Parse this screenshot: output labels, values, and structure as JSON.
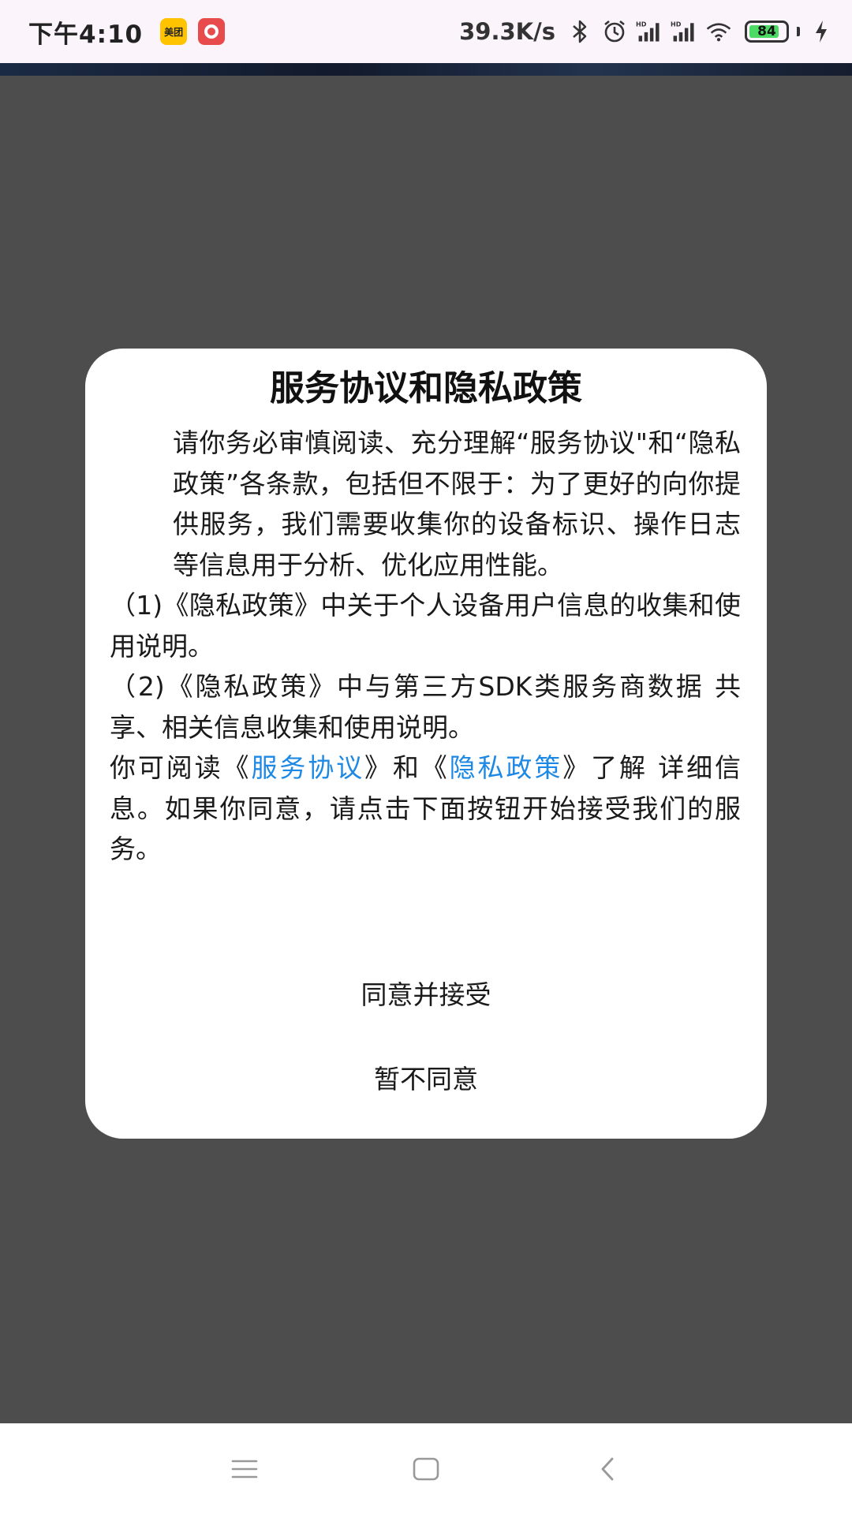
{
  "status_bar": {
    "time": "下午4:10",
    "app_icons": [
      "美团",
      "RED"
    ],
    "network_speed": "39.3K/s",
    "battery_level": "84",
    "battery_fraction": 0.84,
    "icons": [
      "bluetooth-icon",
      "alarm-icon",
      "signal-hd-icon",
      "signal-hd-icon",
      "wifi-icon",
      "battery-icon",
      "charging-icon"
    ]
  },
  "dialog": {
    "title": "服务协议和隐私政策",
    "intro": "请你务必审慎阅读、充分理解“服务协议\"和“隐私政策”各条款，包括但不限于：为了更好的向你提供服务，我们需要收集你的设备标识、操作日志等信息用于分析、优化应用性能。",
    "item1": "（1)《隐私政策》中关于个人设备用户信息的收集和使用说明。",
    "item2": "（2)《隐私政策》中与第三方SDK类服务商数据 共享、相关信息收集和使用说明。",
    "closing_prefix": "你可阅读《",
    "service_link": "服务协议",
    "closing_middle": "》和《",
    "privacy_link": "隐私政策",
    "closing_suffix": "》了解 详细信息。如果你同意，请点击下面按钮开始接受我们的服务。",
    "agree_button": "同意并接受",
    "disagree_button": "暂不同意"
  },
  "nav_bar": {
    "icons": [
      "menu-icon",
      "home-icon",
      "back-icon"
    ]
  },
  "colors": {
    "overlay": "#4d4d4d",
    "status_bar_bg": "#fbf4fb",
    "link": "#1e88e5",
    "battery_fill": "#4cd964"
  }
}
